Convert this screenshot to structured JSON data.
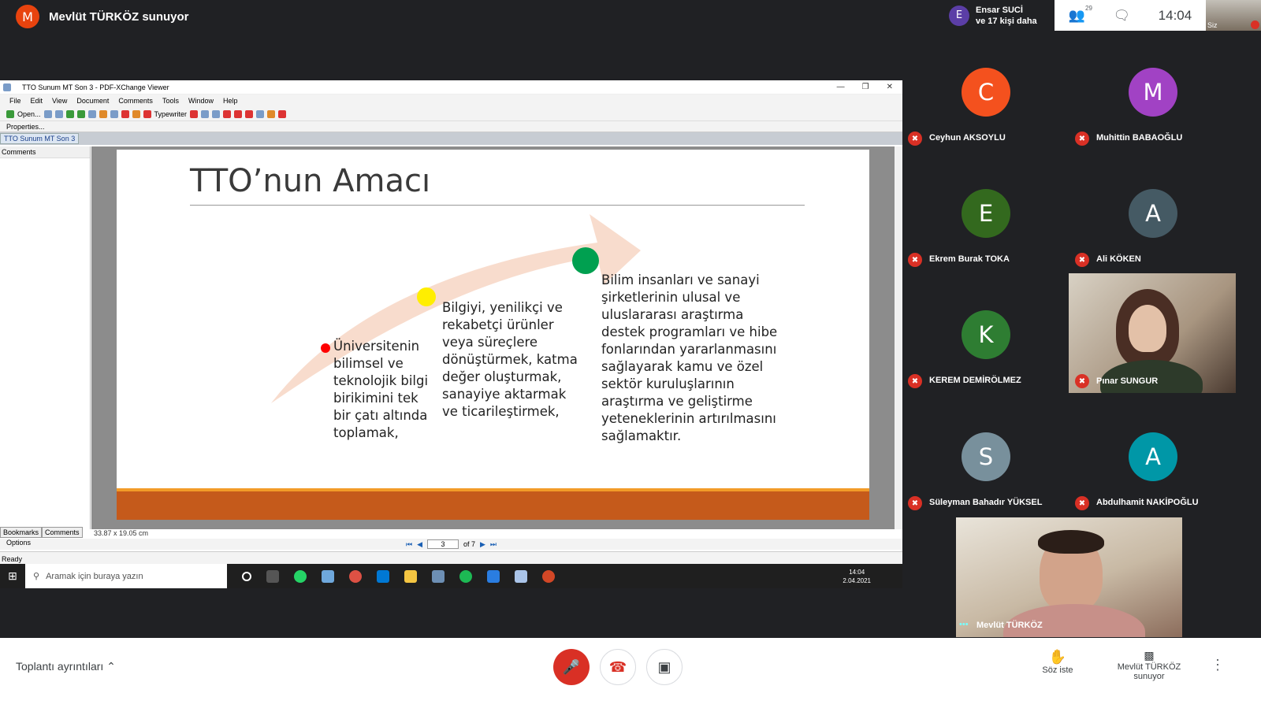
{
  "header": {
    "presenter_initial": "M",
    "presenter_title": "Mevlüt TÜRKÖZ sunuyor",
    "more_initial": "E",
    "more_name": "Ensar SUCİ",
    "more_count": "ve 17 kişi daha",
    "people_count": "29",
    "time": "14:04",
    "self_label": "Siz"
  },
  "viewer": {
    "window_title": "TTO Sunum MT Son 3 - PDF-XChange Viewer",
    "menu": [
      "File",
      "Edit",
      "View",
      "Document",
      "Comments",
      "Tools",
      "Window",
      "Help"
    ],
    "toolbar_open": "Open...",
    "toolbar_typewriter": "Typewriter",
    "properties": "Properties...",
    "doc_tab": "TTO Sunum MT Son 3",
    "comments_header": "Comments",
    "side_tabs": [
      "Bookmarks",
      "Comments"
    ],
    "page_dim": "33.87 x 19.05 cm",
    "options": "Options",
    "page_current": "3",
    "page_total": "of 7",
    "status": "Ready"
  },
  "slide": {
    "title": "TTO’nun Amacı",
    "col1": "Üniversitenin bilimsel ve teknolojik bilgi  birikimini tek bir çatı altında toplamak,",
    "col2": "Bilgiyi, yenilikçi ve rekabetçi ürünler veya süreçlere dönüştürmek, katma değer oluşturmak, sanayiye aktarmak ve ticarileştirmek,",
    "col3": "Bilim insanları ve sanayi şirketlerinin ulusal ve uluslararası araştırma destek programları ve hibe fonlarından yararlanmasını sağlayarak kamu ve özel sektör kuruluşlarının araştırma ve geliştirme yeteneklerinin artırılmasını sağlamaktır."
  },
  "taskbar": {
    "search_placeholder": "Aramak için buraya yazın",
    "time": "14:04",
    "date": "2.04.2021"
  },
  "participants": [
    {
      "initial": "C",
      "name": "Ceyhun AKSOYLU",
      "color": "#f4511e"
    },
    {
      "initial": "M",
      "name": "Muhittin BABAOĞLU",
      "color": "#a142c4"
    },
    {
      "initial": "E",
      "name": "Ekrem Burak TOKA",
      "color": "#33691e"
    },
    {
      "initial": "A",
      "name": "Ali KÖKEN",
      "color": "#455a64"
    },
    {
      "initial": "K",
      "name": "KEREM DEMİRÖLMEZ",
      "color": "#2e7d32"
    },
    {
      "initial": "S",
      "name": "Süleyman Bahadır YÜKSEL",
      "color": "#78909c"
    },
    {
      "initial": "A",
      "name": "Abdulhamit NAKİPOĞLU",
      "color": "#0097a7"
    }
  ],
  "videos": {
    "pinar": "Pınar SUNGUR",
    "mevlut": "Mevlüt TÜRKÖZ"
  },
  "controls": {
    "meeting_details": "Toplantı ayrıntıları",
    "raise_hand": "Söz iste",
    "presenting_line1": "Mevlüt TÜRKÖZ",
    "presenting_line2": "sunuyor"
  }
}
